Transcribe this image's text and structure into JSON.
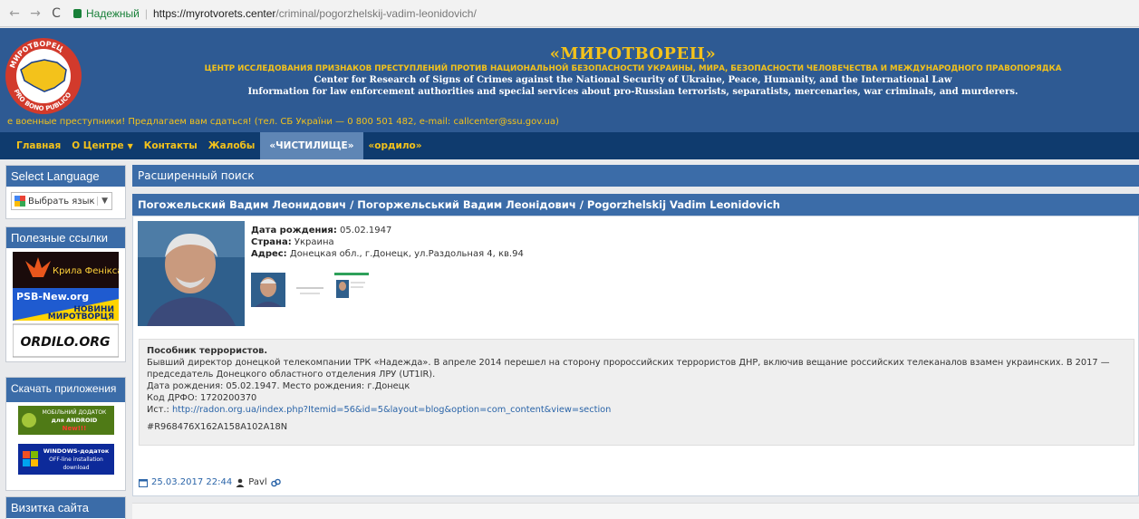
{
  "browser": {
    "secure_label": "Надежный",
    "url_host": "https://myrotvorets.center",
    "url_path": "/criminal/pogorzhelskij-vadim-leonidovich/"
  },
  "header": {
    "logo_top_text": "МИРОТВОРЕЦ",
    "logo_bottom_text": "PRO BONO PUBLICO",
    "title": "«МИРОТВОРЕЦ»",
    "subtitle": "ЦЕНТР ИССЛЕДОВАНИЯ ПРИЗНАКОВ ПРЕСТУПЛЕНИЙ ПРОТИВ НАЦИОНАЛЬНОЙ БЕЗОПАСНОСТИ УКРАИНЫ, МИРА, БЕЗОПАСНОСТИ ЧЕЛОВЕЧЕСТВА И МЕЖДУНАРОДНОГО ПРАВОПОРЯДКА",
    "en_line1": "Center for Research of Signs of Crimes against the National Security of Ukraine, Peace, Humanity, and the International Law",
    "en_line2": "Information for law enforcement authorities and special services about pro-Russian terrorists, separatists, mercenaries, war criminals, and murderers.",
    "ticker": "е военные преступники! Предлагаем вам сдаться! (тел. СБ України — 0 800 501 482, e-mail: callcenter@ssu.gov.ua)"
  },
  "menu": {
    "items": [
      "Главная",
      "О Центре",
      "Контакты",
      "Жалобы",
      "«ЧИСТИЛИЩЕ»",
      "«ордило»"
    ],
    "active": "«ЧИСТИЛИЩЕ»"
  },
  "sidebar": {
    "language_heading": "Select Language",
    "language_select": "Выбрать язык",
    "links_heading": "Полезные ссылки",
    "banner1": "Крила Фенікса",
    "banner2_a": "PSB-New.org",
    "banner2_b": "НОВИНИ",
    "banner2_c": "МИРОТВОРЦЯ",
    "banner3": "ORDILO.ORG",
    "apps_heading": "Скачать приложения",
    "app1_a": "МОБІЛЬНИЙ ДОДАТОК",
    "app1_b": "для ANDROID",
    "app1_c": "New!!!",
    "app2_a": "WINDOWS-додаток",
    "app2_b": "OFF-line installation",
    "app2_c": "download",
    "card_heading": "Визитка сайта"
  },
  "main": {
    "search_bar": "Расширенный поиск",
    "record_title": "Погожельский Вадим Леонидович / Погоржельський Вадим Леонідович / Pogorzhelskij Vadim Leonidovich",
    "dob_label": "Дата рождения:",
    "dob_value": "05.02.1947",
    "country_label": "Страна:",
    "country_value": "Украина",
    "address_label": "Адрес:",
    "address_value": "Донецкая обл., г.Донецк, ул.Раздольная 4, кв.94",
    "desc_lead": "Пособник террористов.",
    "desc_text": "Бывший директор донецкой телекомпании ТРК «Надежда». В апреле 2014 перешел на сторону пророссийских террористов ДНР, включив вещание российских телеканалов взамен украинских. В 2017 — председатель Донецкого областного отделения ЛРУ (UT1IR).",
    "desc_dob": "Дата рождения: 05.02.1947. Место рождения: г.Донецк",
    "desc_code": "Код ДРФО: 1720200370",
    "source_label": "Ист.:",
    "source_link": "http://radon.org.ua/index.php?Itemid=56&id=5&layout=blog&option=com_content&view=section",
    "hash": "#R968476X162A158A102A18N",
    "date": "25.03.2017 22:44",
    "author": "Pavl"
  },
  "colors": {
    "header_bg": "#2e5a93",
    "menu_bg": "#0f3b6e",
    "accent_yellow": "#f3c21b",
    "bar_blue": "#3b6ca8",
    "link_blue": "#2a64a8"
  }
}
